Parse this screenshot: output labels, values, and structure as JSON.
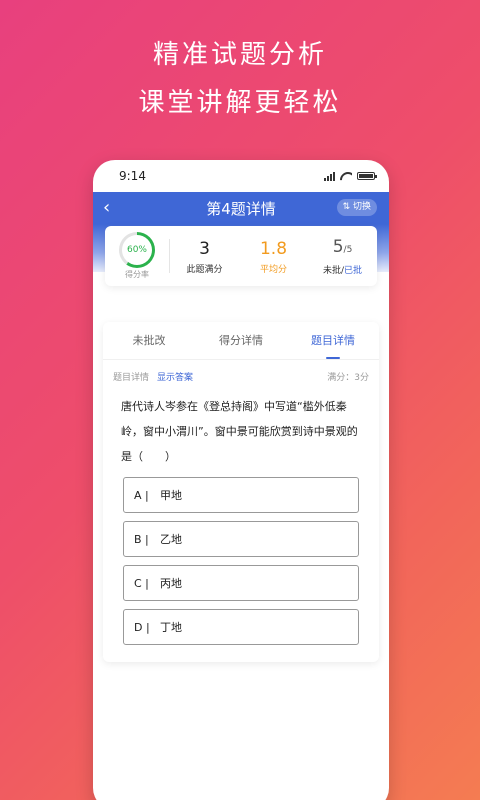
{
  "promo": {
    "line1": "精准试题分析",
    "line2": "课堂讲解更轻松"
  },
  "status": {
    "time": "9:14"
  },
  "nav": {
    "back_icon": "‹",
    "title": "第4题详情",
    "pill": "⇅ 切换"
  },
  "stats": {
    "rate": {
      "percent": 60,
      "value": "60%",
      "label": "得分率"
    },
    "items": [
      {
        "num": "3",
        "label": "此题满分"
      },
      {
        "num": "1.8",
        "label": "平均分"
      },
      {
        "num": "5",
        "num_suffix": "/5",
        "label_a": "未批/",
        "label_b": "已批"
      }
    ]
  },
  "tabs": [
    "未批改",
    "得分详情",
    "题目详情"
  ],
  "meta": {
    "label": "题目详情",
    "show_answer": "显示答案",
    "score": "满分：3分"
  },
  "question": "唐代诗人岑参在《登总持阁》中写道“槛外低秦岭，窗中小渭川”。窗中景可能欣赏到诗中景观的是（　　）",
  "options": [
    {
      "key": "A |",
      "text": "甲地"
    },
    {
      "key": "B |",
      "text": "乙地"
    },
    {
      "key": "C |",
      "text": "丙地"
    },
    {
      "key": "D |",
      "text": "丁地"
    }
  ],
  "colors": {
    "accent": "#3f67d6",
    "green": "#2bb24c",
    "orange": "#f29b1f"
  }
}
